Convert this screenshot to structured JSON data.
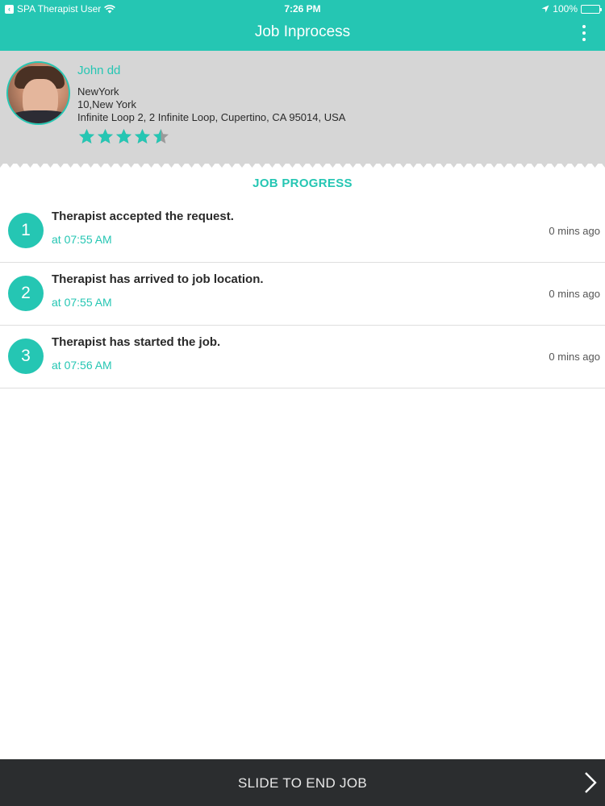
{
  "status_bar": {
    "carrier": "SPA Therapist User",
    "time": "7:26 PM",
    "battery": "100%"
  },
  "header": {
    "title": "Job Inprocess"
  },
  "profile": {
    "name": "John dd",
    "city": "NewYork",
    "address_line1": "10,New York",
    "address_line2": "Infinite Loop 2,  2 Infinite Loop,  Cupertino,  CA 95014,  USA",
    "rating": 4.5,
    "rating_max": 5
  },
  "progress": {
    "title": "JOB PROGRESS",
    "steps": [
      {
        "number": "1",
        "title": "Therapist accepted the request.",
        "time": "at 07:55 AM",
        "ago": "0 mins ago"
      },
      {
        "number": "2",
        "title": "Therapist has arrived to job location.",
        "time": "at 07:55 AM",
        "ago": "0 mins ago"
      },
      {
        "number": "3",
        "title": "Therapist has started the job.",
        "time": "at 07:56 AM",
        "ago": "0 mins ago"
      }
    ]
  },
  "footer": {
    "slide_label": "SLIDE TO END JOB"
  },
  "colors": {
    "accent": "#25c6b3",
    "footer_bg": "#2b2d2f",
    "profile_bg": "#d6d6d6"
  }
}
